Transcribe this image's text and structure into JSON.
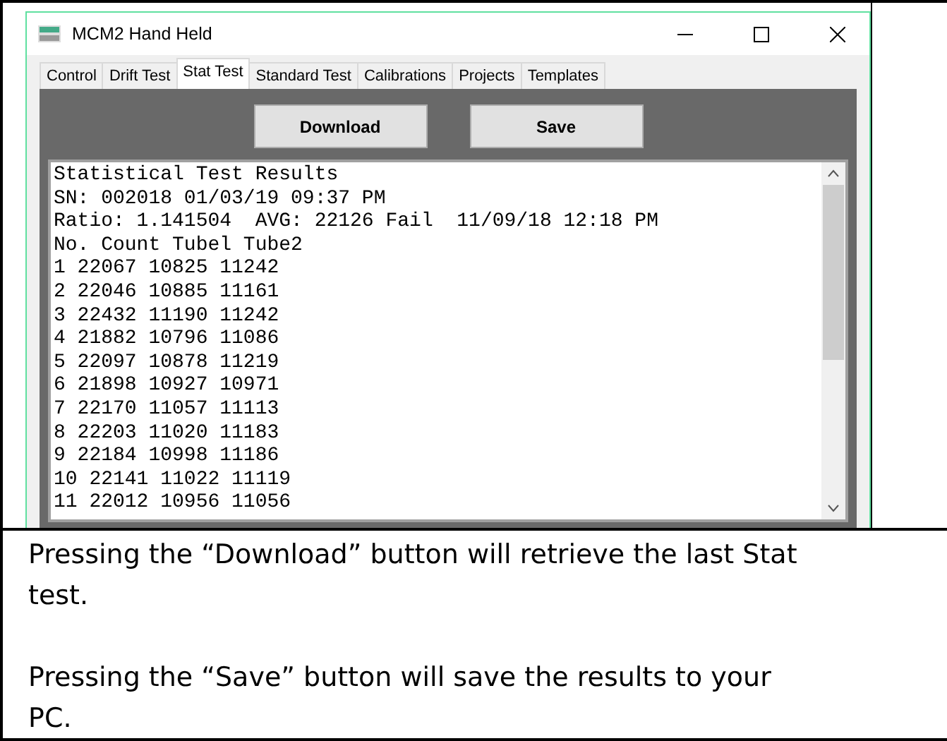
{
  "window": {
    "title": "MCM2 Hand Held"
  },
  "tabs": [
    {
      "label": "Control",
      "selected": false
    },
    {
      "label": "Drift Test",
      "selected": false
    },
    {
      "label": "Stat Test",
      "selected": true
    },
    {
      "label": "Standard Test",
      "selected": false
    },
    {
      "label": "Calibrations",
      "selected": false
    },
    {
      "label": "Projects",
      "selected": false
    },
    {
      "label": "Templates",
      "selected": false
    }
  ],
  "buttons": [
    "Download",
    "Save"
  ],
  "results": [
    "Statistical Test Results",
    "SN: 002018 01/03/19 09:37 PM",
    "Ratio: 1.141504  AVG: 22126 Fail  11/09/18 12:18 PM",
    "No. Count Tubel Tube2",
    "1 22067 10825 11242",
    "2 22046 10885 11161",
    "3 22432 11190 11242",
    "4 21882 10796 11086",
    "5 22097 10878 11219",
    "6 21898 10927 10971",
    "7 22170 11057 11113",
    "8 22203 11020 11183",
    "9 22184 10998 11186",
    "10 22141 11022 11119",
    "11 22012 10956 11056"
  ],
  "description": [
    "Pressing the “Download” button will retrieve the last Stat test.",
    "Pressing the “Save” button will save the results to your PC."
  ]
}
